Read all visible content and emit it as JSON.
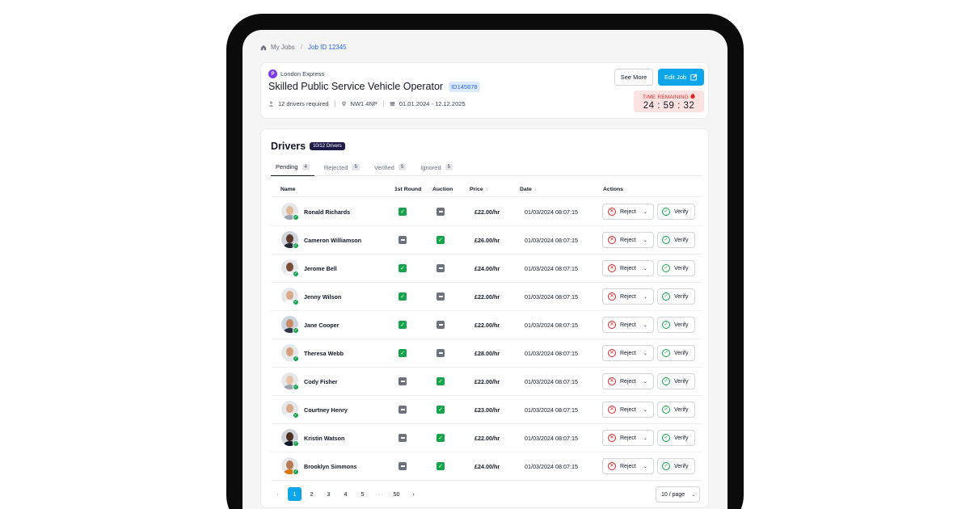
{
  "breadcrumb": {
    "home": "My Jobs",
    "separator": "/",
    "current": "Job ID 12345"
  },
  "job": {
    "company_initial": "P",
    "company": "London Express",
    "title": "Skilled Public Service Vehicle Operator",
    "id_badge": "ID145678",
    "drivers_required": "12 drivers required",
    "location": "NW1 4NP",
    "dates": "01.01.2024 - 12.12.2025",
    "see_more": "See More",
    "edit_job": "Edit Job",
    "time_label": "TIME REMAINING",
    "time_value": "24 : 59 : 32"
  },
  "drivers": {
    "title": "Drivers",
    "badge": "10/12 Drivers",
    "tabs": [
      {
        "label": "Pending",
        "count": "4"
      },
      {
        "label": "Rejected",
        "count": "5"
      },
      {
        "label": "Verified",
        "count": "5"
      },
      {
        "label": "Ignored",
        "count": "5"
      }
    ],
    "columns": {
      "name": "Name",
      "round1": "1st Round",
      "auction": "Auction",
      "price": "Price",
      "date": "Date",
      "actions": "Actions"
    },
    "sort_arrow": "↓",
    "reject_label": "Reject",
    "verify_label": "Verify",
    "rows": [
      {
        "name": "Ronald Richards",
        "round1": true,
        "auction": false,
        "price": "£22.00/hr",
        "date": "01/03/2024 08:07:15",
        "skin": "#e0b89a",
        "shirt": "#9ca3af",
        "bg": "#e5e7eb"
      },
      {
        "name": "Cameron Williamson",
        "round1": false,
        "auction": true,
        "price": "£26.00/hr",
        "date": "01/03/2024 08:07:15",
        "skin": "#5b3a29",
        "shirt": "#1f2937",
        "bg": "#d1d5db"
      },
      {
        "name": "Jerome Bell",
        "round1": true,
        "auction": false,
        "price": "£24.00/hr",
        "date": "01/03/2024 08:07:15",
        "skin": "#7a4e35",
        "shirt": "#f3f4f6",
        "bg": "#e5e7eb"
      },
      {
        "name": "Jenny Wilson",
        "round1": true,
        "auction": false,
        "price": "£22.00/hr",
        "date": "01/03/2024 08:07:15",
        "skin": "#d9a98a",
        "shirt": "#f9fafb",
        "bg": "#e5e7eb"
      },
      {
        "name": "Jane Cooper",
        "round1": true,
        "auction": false,
        "price": "£22.00/hr",
        "date": "01/03/2024 08:07:15",
        "skin": "#c88b66",
        "shirt": "#2d3748",
        "bg": "#cbd5e1"
      },
      {
        "name": "Theresa Webb",
        "round1": true,
        "auction": false,
        "price": "£28.00/hr",
        "date": "01/03/2024 08:07:15",
        "skin": "#d6a07e",
        "shirt": "#e5e7eb",
        "bg": "#e5e7eb"
      },
      {
        "name": "Cody Fisher",
        "round1": false,
        "auction": true,
        "price": "£22.00/hr",
        "date": "01/03/2024 08:07:15",
        "skin": "#e8c2a6",
        "shirt": "#9ca3af",
        "bg": "#e5e7eb"
      },
      {
        "name": "Courtney Henry",
        "round1": false,
        "auction": true,
        "price": "£23.00/hr",
        "date": "01/03/2024 08:07:15",
        "skin": "#d9a98a",
        "shirt": "#f3f4f6",
        "bg": "#e5e7eb"
      },
      {
        "name": "Kristin Watson",
        "round1": false,
        "auction": true,
        "price": "£22.00/hr",
        "date": "01/03/2024 08:07:15",
        "skin": "#4a2e20",
        "shirt": "#111827",
        "bg": "#d1d5db"
      },
      {
        "name": "Brooklyn Simmons",
        "round1": false,
        "auction": true,
        "price": "£24.00/hr",
        "date": "01/03/2024 08:07:15",
        "skin": "#b57a52",
        "shirt": "#d97706",
        "bg": "#e5e7eb"
      }
    ]
  },
  "pagination": {
    "pages": [
      "1",
      "2",
      "3",
      "4",
      "5"
    ],
    "ellipsis": "···",
    "last": "50",
    "current": "1",
    "per_page": "10 / page"
  },
  "colors": {
    "accent": "#0ea5e9",
    "success": "#16a34a",
    "danger": "#dc2626",
    "badge_dark": "#1e1b4b"
  }
}
